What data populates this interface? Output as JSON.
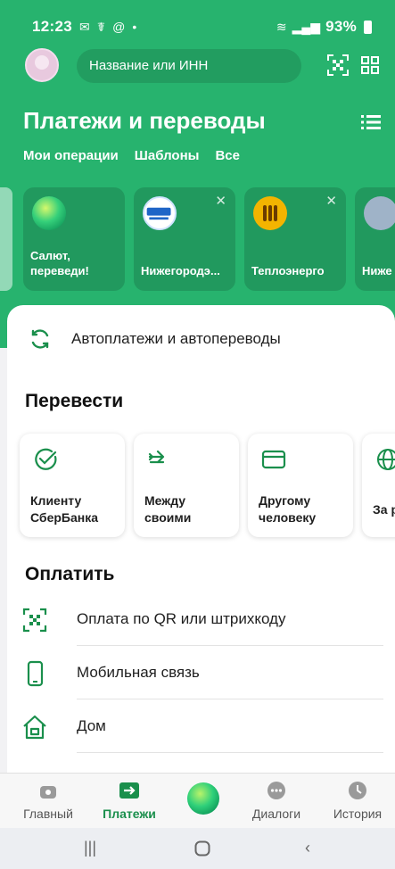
{
  "status": {
    "time": "12:23",
    "battery": "93%"
  },
  "search": {
    "placeholder": "Название или ИНН"
  },
  "header": {
    "title": "Платежи и переводы"
  },
  "filters": [
    "Мои операции",
    "Шаблоны",
    "Все"
  ],
  "quick_cards": [
    {
      "label_line1": "Салют,",
      "label_line2": "переведи!"
    },
    {
      "label_line1": "Нижегородэ..."
    },
    {
      "label_line1": "Теплоэнерго"
    },
    {
      "label_line1": "Ниже"
    }
  ],
  "autopay": {
    "label": "Автоплатежи и автопереводы"
  },
  "transfer": {
    "title": "Перевести",
    "cards": [
      {
        "line1": "Клиенту",
        "line2": "СберБанка"
      },
      {
        "line1": "Между",
        "line2": "своими"
      },
      {
        "line1": "Другому",
        "line2": "человеку"
      },
      {
        "line1": "За ру"
      }
    ]
  },
  "pay": {
    "title": "Оплатить",
    "items": [
      "Оплата по QR или штрихкоду",
      "Мобильная связь",
      "Дом"
    ]
  },
  "nav": {
    "main": "Главный",
    "payments": "Платежи",
    "dialogs": "Диалоги",
    "history": "История"
  },
  "colors": {
    "brand_green": "#27b36e",
    "accent_green": "#1a8f4c"
  }
}
